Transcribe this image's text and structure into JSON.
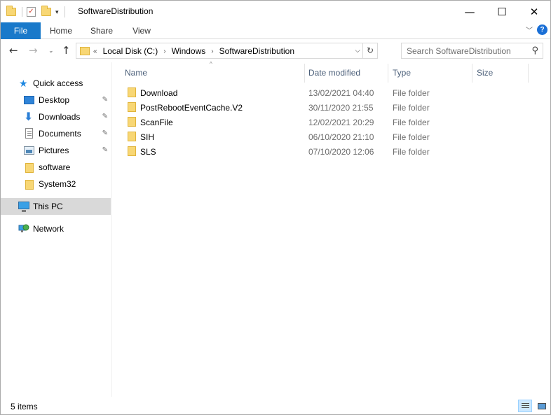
{
  "window": {
    "title": "SoftwareDistribution",
    "minimize": "—",
    "maximize": "☐",
    "close": "✕"
  },
  "quick_access_toolbar": {
    "dropdown": "▾"
  },
  "ribbon": {
    "tabs": [
      {
        "label": "File"
      },
      {
        "label": "Home"
      },
      {
        "label": "Share"
      },
      {
        "label": "View"
      }
    ],
    "expand": "﹀",
    "help": "?"
  },
  "address": {
    "overflow": "«",
    "crumbs": [
      "Local Disk (C:)",
      "Windows",
      "SoftwareDistribution"
    ],
    "separator": "›",
    "dropdown": "⌵",
    "refresh": "↻"
  },
  "nav": {
    "back": "←",
    "forward": "→",
    "recent": "⌄",
    "up": "↑"
  },
  "search": {
    "placeholder": "Search SoftwareDistribution",
    "icon": "⚲"
  },
  "sidebar": {
    "pin": "📌",
    "items": [
      {
        "label": "Quick access",
        "icon": "star-icon"
      },
      {
        "label": "Desktop",
        "icon": "desktop-icon",
        "pinned": true
      },
      {
        "label": "Downloads",
        "icon": "downloads-icon",
        "pinned": true
      },
      {
        "label": "Documents",
        "icon": "documents-icon",
        "pinned": true
      },
      {
        "label": "Pictures",
        "icon": "pictures-icon",
        "pinned": true
      },
      {
        "label": "software",
        "icon": "folder-icon"
      },
      {
        "label": "System32",
        "icon": "folder-icon"
      },
      {
        "label": "This PC",
        "icon": "computer-icon",
        "selected": true
      },
      {
        "label": "Network",
        "icon": "network-icon"
      }
    ]
  },
  "columns": {
    "name": "Name",
    "date": "Date modified",
    "type": "Type",
    "size": "Size",
    "sort_indicator": "^"
  },
  "files": [
    {
      "name": "Download",
      "date": "13/02/2021 04:40",
      "type": "File folder"
    },
    {
      "name": "PostRebootEventCache.V2",
      "date": "30/11/2020 21:55",
      "type": "File folder"
    },
    {
      "name": "ScanFile",
      "date": "12/02/2021 20:29",
      "type": "File folder"
    },
    {
      "name": "SIH",
      "date": "06/10/2020 21:10",
      "type": "File folder"
    },
    {
      "name": "SLS",
      "date": "07/10/2020 12:06",
      "type": "File folder"
    }
  ],
  "status": {
    "item_count": "5 items"
  },
  "colors": {
    "file_tab": "#1979ca",
    "selected_nav": "#d9d9d9",
    "folder": "#f8d775",
    "header_text": "#4c607a",
    "meta_text": "#6d6d6d"
  }
}
